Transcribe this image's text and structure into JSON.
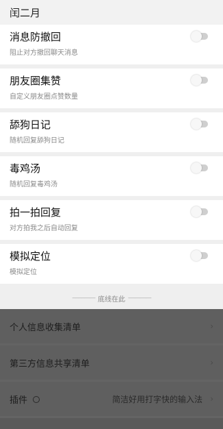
{
  "header": {
    "title": "闰二月"
  },
  "settings": [
    {
      "title": "消息防撤回",
      "sub": "阻止对方撤回聊天消息",
      "enabled": false
    },
    {
      "title": "朋友圈集赞",
      "sub": "自定义朋友圈点赞数量",
      "enabled": false
    },
    {
      "title": "舔狗日记",
      "sub": "随机回复舔狗日记",
      "enabled": false
    },
    {
      "title": "毒鸡汤",
      "sub": "随机回复毒鸡汤",
      "enabled": false
    },
    {
      "title": "拍一拍回复",
      "sub": "对方拍我之后自动回复",
      "enabled": false
    },
    {
      "title": "模拟定位",
      "sub": "模拟定位",
      "enabled": false
    }
  ],
  "footer": {
    "dash_left": "---------------",
    "text": "底线在此",
    "dash_right": "---------------"
  },
  "bottom_menu": {
    "personal_info": "个人信息收集清单",
    "third_party": "第三方信息共享清单",
    "plugin_label": "插件",
    "plugin_hint": "简洁好用打字快的输入法",
    "chevron": "›"
  }
}
